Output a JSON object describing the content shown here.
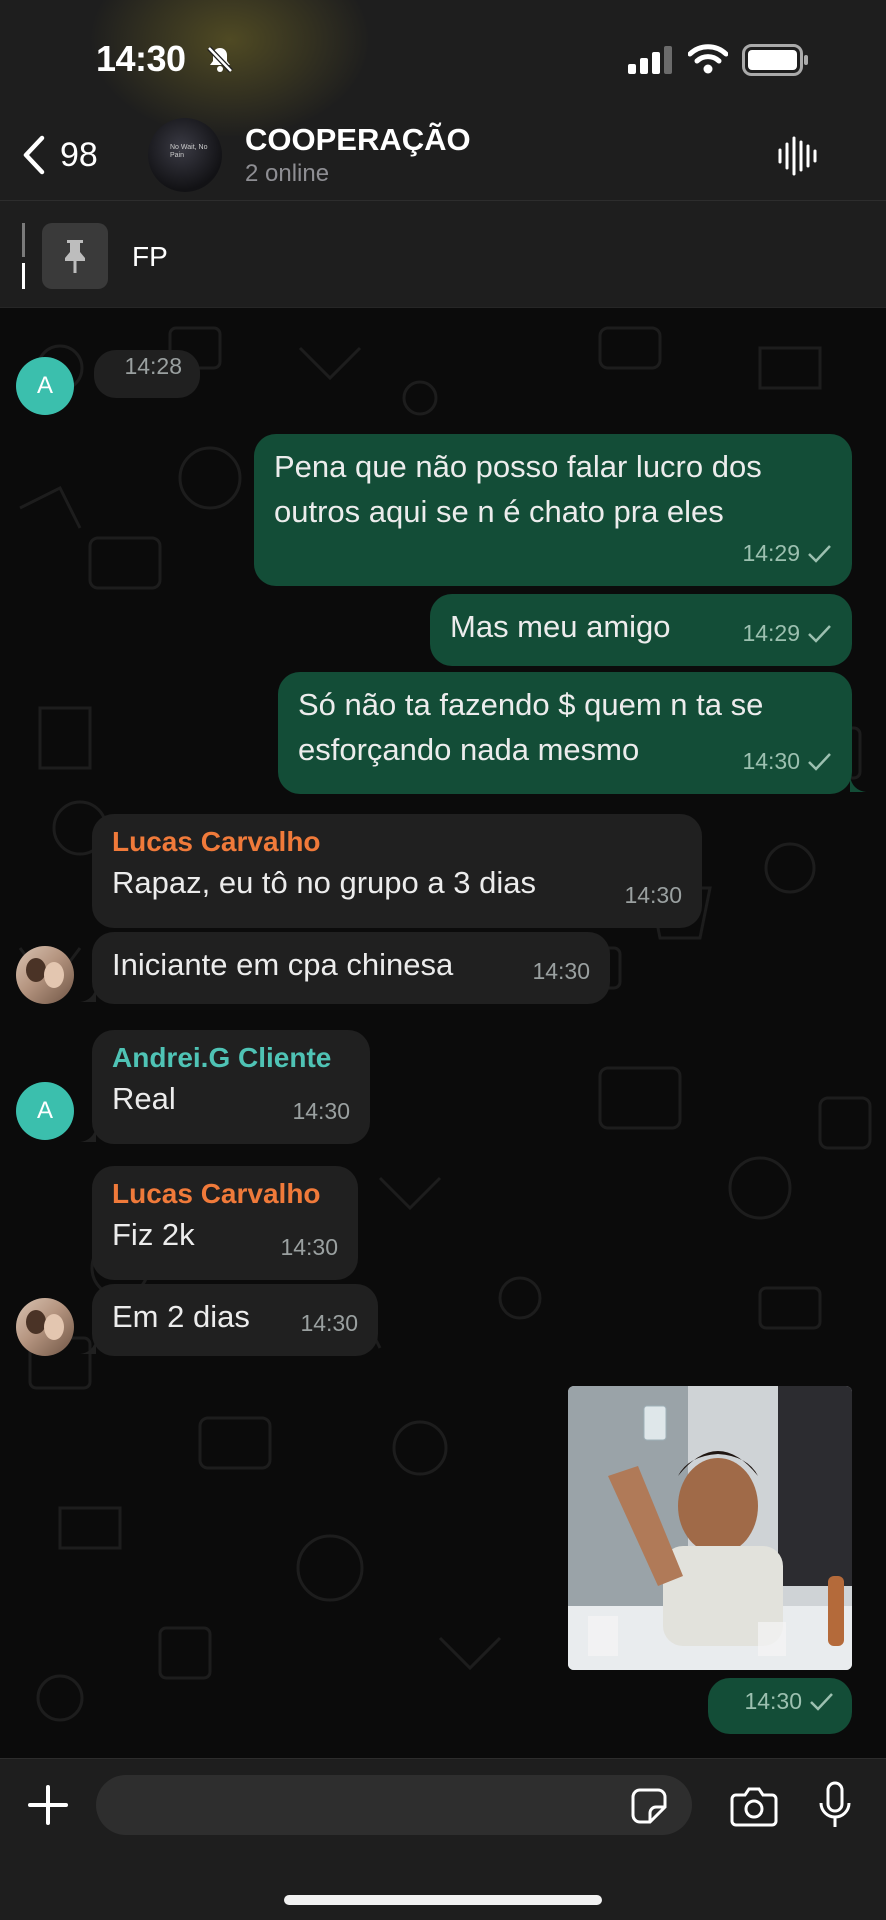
{
  "status_bar": {
    "time": "14:30",
    "icons": [
      "bell-slash-icon",
      "cellular-signal-icon",
      "wifi-icon",
      "battery-icon"
    ]
  },
  "header": {
    "back_count": "98",
    "title": "COOPERAÇÃO",
    "subtitle": "2 online",
    "avatar_text": "No Wait, No Pain",
    "action_icon": "waveform-icon"
  },
  "pinned": {
    "text": "FP",
    "icon": "pin-icon"
  },
  "messages": [
    {
      "id": 1,
      "direction": "in",
      "avatar": "A",
      "time": "14:28",
      "text": ""
    },
    {
      "id": 2,
      "direction": "out",
      "text": "Pena que não posso falar lucro dos outros aqui se n é chato pra eles",
      "time": "14:29",
      "status": "sent"
    },
    {
      "id": 3,
      "direction": "out",
      "text": "Mas meu amigo",
      "time": "14:29",
      "status": "sent"
    },
    {
      "id": 4,
      "direction": "out",
      "text": "Só não ta fazendo $ quem n ta se esforçando nada mesmo",
      "time": "14:30",
      "status": "sent"
    },
    {
      "id": 5,
      "direction": "in",
      "sender": "Lucas Carvalho",
      "text": "Rapaz, eu tô no grupo a 3 dias",
      "time": "14:30"
    },
    {
      "id": 6,
      "direction": "in",
      "text": "Iniciante em cpa chinesa",
      "time": "14:30"
    },
    {
      "id": 7,
      "direction": "in",
      "sender": "Andrei.G Cliente",
      "avatar": "A",
      "text": "Real",
      "time": "14:30"
    },
    {
      "id": 8,
      "direction": "in",
      "sender": "Lucas Carvalho",
      "text": "Fiz 2k",
      "time": "14:30"
    },
    {
      "id": 9,
      "direction": "in",
      "text": "Em 2 dias",
      "time": "14:30"
    },
    {
      "id": 10,
      "direction": "out",
      "type": "gif",
      "time": "14:30",
      "status": "sent"
    }
  ],
  "colors": {
    "outgoing_bubble": "#134d37",
    "incoming_bubble": "#202020",
    "sender_lucas": "#f07a3a",
    "sender_andrei": "#4fc3b5",
    "avatar_a": "#3bbfad"
  },
  "input": {
    "placeholder": "",
    "left_icon": "plus-icon",
    "icons": [
      "sticker-icon",
      "camera-icon",
      "microphone-icon"
    ]
  }
}
